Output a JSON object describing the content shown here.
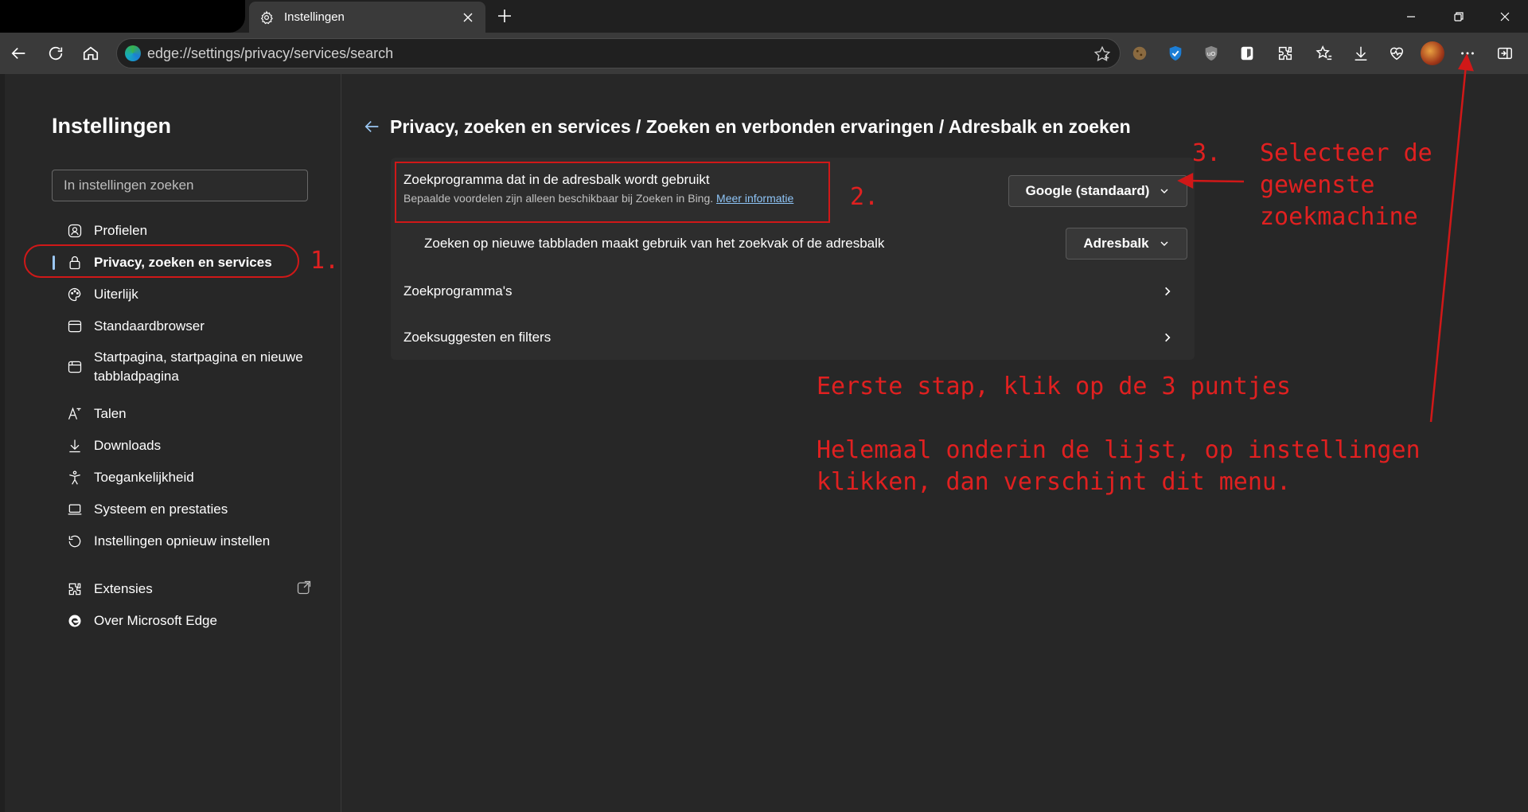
{
  "tab": {
    "title": "Instellingen"
  },
  "address": {
    "url": "edge://settings/privacy/services/search"
  },
  "sidebar": {
    "title": "Instellingen",
    "search_placeholder": "In instellingen zoeken",
    "items": [
      {
        "label": "Profielen"
      },
      {
        "label": "Privacy, zoeken en services"
      },
      {
        "label": "Uiterlijk"
      },
      {
        "label": "Standaardbrowser"
      },
      {
        "label": "Startpagina, startpagina en nieuwe tabbladpagina"
      },
      {
        "label": "Talen"
      },
      {
        "label": "Downloads"
      },
      {
        "label": "Toegankelijkheid"
      },
      {
        "label": "Systeem en prestaties"
      },
      {
        "label": "Instellingen opnieuw instellen"
      },
      {
        "label": "Extensies"
      },
      {
        "label": "Over Microsoft Edge"
      }
    ]
  },
  "main": {
    "breadcrumb": "Privacy, zoeken en services / Zoeken en verbonden ervaringen / Adresbalk en zoeken",
    "rows": [
      {
        "title": "Zoekprogramma dat in de adresbalk wordt gebruikt",
        "sub": "Bepaalde voordelen zijn alleen beschikbaar bij Zoeken in Bing.",
        "link": "Meer informatie",
        "dropdown": "Google (standaard)"
      },
      {
        "title": "Zoeken op nieuwe tabbladen maakt gebruik van het zoekvak of de adresbalk",
        "dropdown": "Adresbalk"
      },
      {
        "title": "Zoekprogramma's"
      },
      {
        "title": "Zoeksuggesten en filters"
      }
    ]
  },
  "annotations": {
    "step1": "1.",
    "step2": "2.",
    "step3_num": "3.",
    "step3_text": "Selecteer de\ngewenste\nzoekmachine",
    "first_step": "Eerste stap, klik op de 3 puntjes",
    "bottom_note": "Helemaal onderin de lijst, op instellingen\nklikken, dan verschijnt dit menu.",
    "color": "#e02020"
  }
}
